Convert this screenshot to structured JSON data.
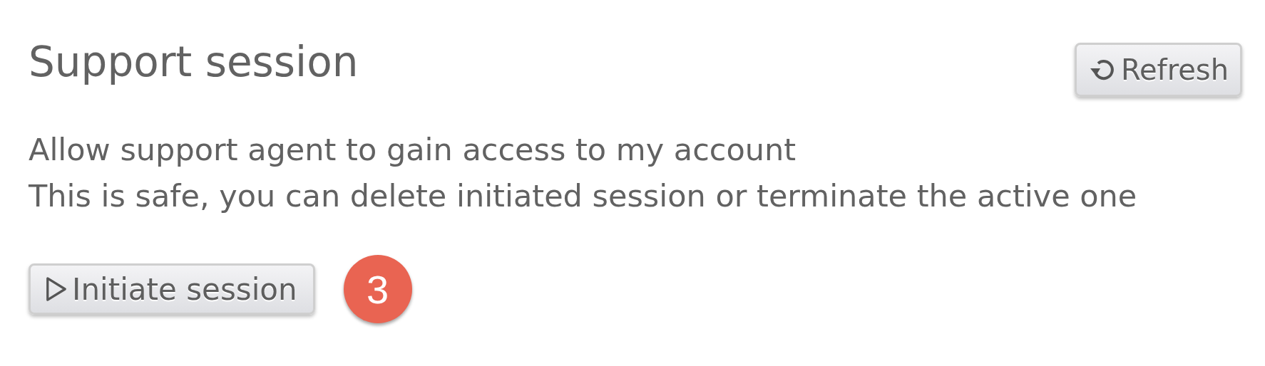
{
  "title": "Support session",
  "refresh_button": {
    "label": "Refresh"
  },
  "description": [
    "Allow support agent to gain access to my account",
    "This is safe, you can delete initiated session or terminate the active one"
  ],
  "initiate_button": {
    "label": "Initiate session"
  },
  "step_badge": {
    "label": "3",
    "color": "#e96452"
  }
}
